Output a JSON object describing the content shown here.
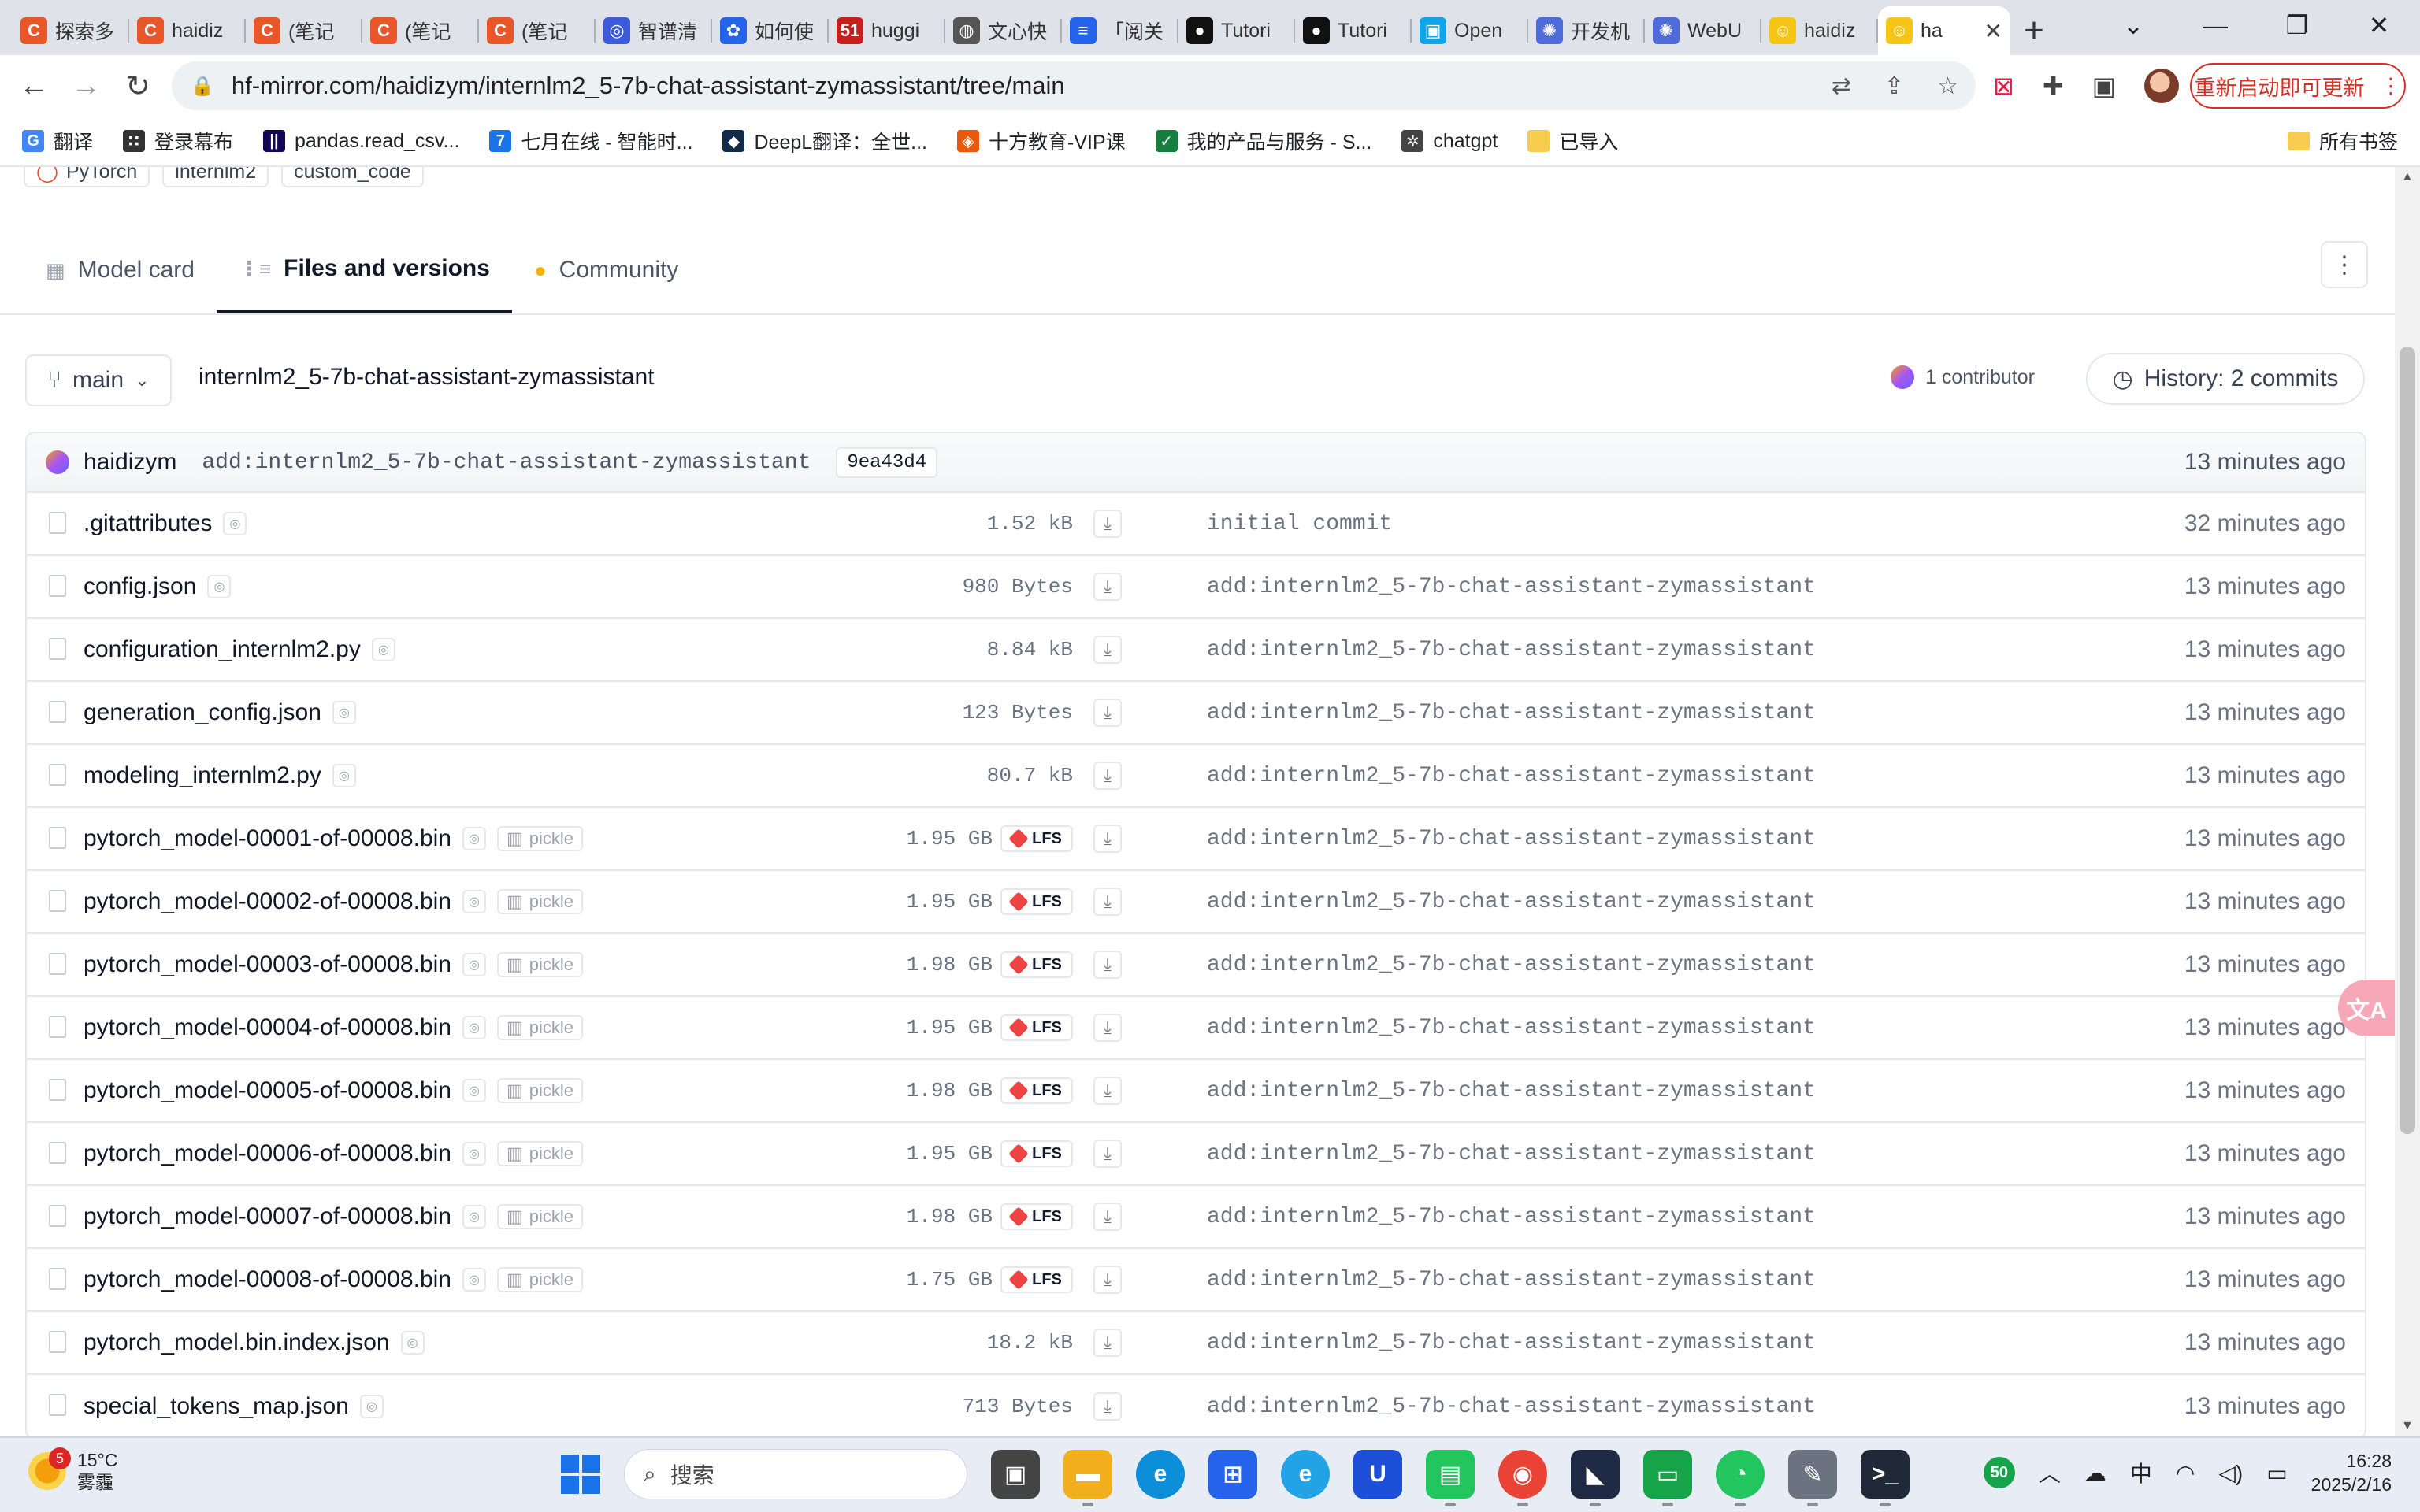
{
  "browser": {
    "tabs": [
      {
        "label": "探索多",
        "icon": "C",
        "color": "#e8562a"
      },
      {
        "label": "haidiz",
        "icon": "C",
        "color": "#e8562a"
      },
      {
        "label": "(笔记",
        "icon": "C",
        "color": "#e8562a"
      },
      {
        "label": "(笔记",
        "icon": "C",
        "color": "#e8562a"
      },
      {
        "label": "(笔记",
        "icon": "C",
        "color": "#e8562a"
      },
      {
        "label": "智谱清",
        "icon": "◎",
        "color": "#3b5bdb"
      },
      {
        "label": "如何使",
        "icon": "✿",
        "color": "#2563eb"
      },
      {
        "label": "huggi",
        "icon": "51",
        "color": "#c81e1e"
      },
      {
        "label": "文心快",
        "icon": "◍",
        "color": "#555555"
      },
      {
        "label": "「阅关",
        "icon": "≡",
        "color": "#2563eb"
      },
      {
        "label": "Tutori",
        "icon": "●",
        "color": "#111111"
      },
      {
        "label": "Tutori",
        "icon": "●",
        "color": "#111111"
      },
      {
        "label": "Open",
        "icon": "▣",
        "color": "#0ea5e9"
      },
      {
        "label": "开发机",
        "icon": "✺",
        "color": "#4f6bd8"
      },
      {
        "label": "WebU",
        "icon": "✺",
        "color": "#4f6bd8"
      },
      {
        "label": "haidiz",
        "icon": "☺",
        "color": "#f5c518"
      }
    ],
    "active_tab": {
      "label": "ha",
      "icon": "☺",
      "color": "#f5c518"
    },
    "url": "hf-mirror.com/haidizym/internlm2_5-7b-chat-assistant-zymassistant/tree/main",
    "update_button": "重新启动即可更新",
    "bookmarks": [
      {
        "label": "翻译",
        "icon": "G",
        "color": "#4285f4"
      },
      {
        "label": "登录幕布",
        "icon": "∷",
        "color": "#333333"
      },
      {
        "label": "pandas.read_csv...",
        "icon": "||",
        "color": "#130654"
      },
      {
        "label": "七月在线 - 智能时...",
        "icon": "7",
        "color": "#1a73e8"
      },
      {
        "label": "DeepL翻译：全世...",
        "icon": "◆",
        "color": "#0f2b46"
      },
      {
        "label": "十方教育-VIP课",
        "icon": "◈",
        "color": "#ea580c"
      },
      {
        "label": "我的产品与服务 - S...",
        "icon": "✓",
        "color": "#15803d"
      },
      {
        "label": "chatgpt",
        "icon": "✲",
        "color": "#444444"
      },
      {
        "label": "已导入",
        "icon": "",
        "color": "#f7cb4d"
      }
    ],
    "all_bookmarks": "所有书签"
  },
  "repo": {
    "tags": [
      "PyTorch",
      "internlm2",
      "custom_code"
    ],
    "tabs": [
      {
        "label": "Model card",
        "icon": "▦"
      },
      {
        "label": "Files and versions",
        "icon": "⋮≡"
      },
      {
        "label": "Community",
        "icon": "●"
      }
    ],
    "branch": "main",
    "path": "internlm2_5-7b-chat-assistant-zymassistant",
    "contributors": "1 contributor",
    "history": "History: 2 commits",
    "last_commit": {
      "author": "haidizym",
      "message": "add:internlm2_5-7b-chat-assistant-zymassistant",
      "hash": "9ea43d4",
      "time": "13 minutes ago"
    },
    "files": [
      {
        "name": ".gitattributes",
        "size": "1.52 kB",
        "lfs": false,
        "pickle": false,
        "msg": "initial commit",
        "time": "32 minutes ago"
      },
      {
        "name": "config.json",
        "size": "980 Bytes",
        "lfs": false,
        "pickle": false,
        "msg": "add:internlm2_5-7b-chat-assistant-zymassistant",
        "time": "13 minutes ago"
      },
      {
        "name": "configuration_internlm2.py",
        "size": "8.84 kB",
        "lfs": false,
        "pickle": false,
        "msg": "add:internlm2_5-7b-chat-assistant-zymassistant",
        "time": "13 minutes ago"
      },
      {
        "name": "generation_config.json",
        "size": "123 Bytes",
        "lfs": false,
        "pickle": false,
        "msg": "add:internlm2_5-7b-chat-assistant-zymassistant",
        "time": "13 minutes ago"
      },
      {
        "name": "modeling_internlm2.py",
        "size": "80.7 kB",
        "lfs": false,
        "pickle": false,
        "msg": "add:internlm2_5-7b-chat-assistant-zymassistant",
        "time": "13 minutes ago"
      },
      {
        "name": "pytorch_model-00001-of-00008.bin",
        "size": "1.95 GB",
        "lfs": true,
        "pickle": true,
        "msg": "add:internlm2_5-7b-chat-assistant-zymassistant",
        "time": "13 minutes ago"
      },
      {
        "name": "pytorch_model-00002-of-00008.bin",
        "size": "1.95 GB",
        "lfs": true,
        "pickle": true,
        "msg": "add:internlm2_5-7b-chat-assistant-zymassistant",
        "time": "13 minutes ago"
      },
      {
        "name": "pytorch_model-00003-of-00008.bin",
        "size": "1.98 GB",
        "lfs": true,
        "pickle": true,
        "msg": "add:internlm2_5-7b-chat-assistant-zymassistant",
        "time": "13 minutes ago"
      },
      {
        "name": "pytorch_model-00004-of-00008.bin",
        "size": "1.95 GB",
        "lfs": true,
        "pickle": true,
        "msg": "add:internlm2_5-7b-chat-assistant-zymassistant",
        "time": "13 minutes ago"
      },
      {
        "name": "pytorch_model-00005-of-00008.bin",
        "size": "1.98 GB",
        "lfs": true,
        "pickle": true,
        "msg": "add:internlm2_5-7b-chat-assistant-zymassistant",
        "time": "13 minutes ago"
      },
      {
        "name": "pytorch_model-00006-of-00008.bin",
        "size": "1.95 GB",
        "lfs": true,
        "pickle": true,
        "msg": "add:internlm2_5-7b-chat-assistant-zymassistant",
        "time": "13 minutes ago"
      },
      {
        "name": "pytorch_model-00007-of-00008.bin",
        "size": "1.98 GB",
        "lfs": true,
        "pickle": true,
        "msg": "add:internlm2_5-7b-chat-assistant-zymassistant",
        "time": "13 minutes ago"
      },
      {
        "name": "pytorch_model-00008-of-00008.bin",
        "size": "1.75 GB",
        "lfs": true,
        "pickle": true,
        "msg": "add:internlm2_5-7b-chat-assistant-zymassistant",
        "time": "13 minutes ago"
      },
      {
        "name": "pytorch_model.bin.index.json",
        "size": "18.2 kB",
        "lfs": false,
        "pickle": false,
        "msg": "add:internlm2_5-7b-chat-assistant-zymassistant",
        "time": "13 minutes ago"
      },
      {
        "name": "special_tokens_map.json",
        "size": "713 Bytes",
        "lfs": false,
        "pickle": false,
        "msg": "add:internlm2_5-7b-chat-assistant-zymassistant",
        "time": "13 minutes ago"
      }
    ],
    "pickle_label": "pickle",
    "lfs_label": "LFS"
  },
  "taskbar": {
    "weather_temp": "15°C",
    "weather_desc": "雾霾",
    "weather_badge": "5",
    "search_label": "搜索",
    "tray_badge": "50",
    "ime": "中",
    "time": "16:28",
    "date": "2025/2/16"
  }
}
